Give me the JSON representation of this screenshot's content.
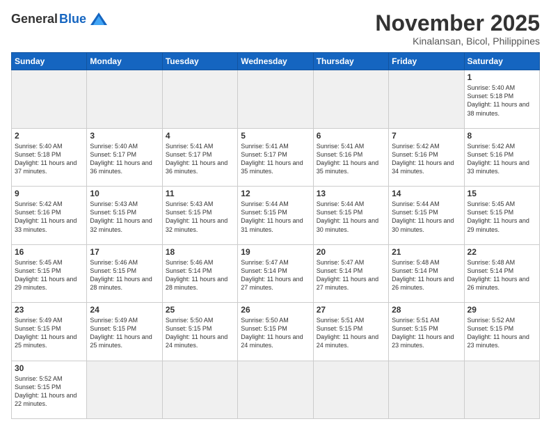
{
  "header": {
    "logo_general": "General",
    "logo_blue": "Blue",
    "month_title": "November 2025",
    "location": "Kinalansan, Bicol, Philippines"
  },
  "days_of_week": [
    "Sunday",
    "Monday",
    "Tuesday",
    "Wednesday",
    "Thursday",
    "Friday",
    "Saturday"
  ],
  "weeks": [
    [
      {
        "day": "",
        "empty": true
      },
      {
        "day": "",
        "empty": true
      },
      {
        "day": "",
        "empty": true
      },
      {
        "day": "",
        "empty": true
      },
      {
        "day": "",
        "empty": true
      },
      {
        "day": "",
        "empty": true
      },
      {
        "day": "1",
        "sunrise": "5:40 AM",
        "sunset": "5:18 PM",
        "daylight": "11 hours and 38 minutes."
      }
    ],
    [
      {
        "day": "2",
        "sunrise": "5:40 AM",
        "sunset": "5:18 PM",
        "daylight": "11 hours and 37 minutes."
      },
      {
        "day": "3",
        "sunrise": "5:40 AM",
        "sunset": "5:17 PM",
        "daylight": "11 hours and 36 minutes."
      },
      {
        "day": "4",
        "sunrise": "5:41 AM",
        "sunset": "5:17 PM",
        "daylight": "11 hours and 36 minutes."
      },
      {
        "day": "5",
        "sunrise": "5:41 AM",
        "sunset": "5:17 PM",
        "daylight": "11 hours and 35 minutes."
      },
      {
        "day": "6",
        "sunrise": "5:41 AM",
        "sunset": "5:16 PM",
        "daylight": "11 hours and 35 minutes."
      },
      {
        "day": "7",
        "sunrise": "5:42 AM",
        "sunset": "5:16 PM",
        "daylight": "11 hours and 34 minutes."
      },
      {
        "day": "8",
        "sunrise": "5:42 AM",
        "sunset": "5:16 PM",
        "daylight": "11 hours and 33 minutes."
      }
    ],
    [
      {
        "day": "9",
        "sunrise": "5:42 AM",
        "sunset": "5:16 PM",
        "daylight": "11 hours and 33 minutes."
      },
      {
        "day": "10",
        "sunrise": "5:43 AM",
        "sunset": "5:15 PM",
        "daylight": "11 hours and 32 minutes."
      },
      {
        "day": "11",
        "sunrise": "5:43 AM",
        "sunset": "5:15 PM",
        "daylight": "11 hours and 32 minutes."
      },
      {
        "day": "12",
        "sunrise": "5:44 AM",
        "sunset": "5:15 PM",
        "daylight": "11 hours and 31 minutes."
      },
      {
        "day": "13",
        "sunrise": "5:44 AM",
        "sunset": "5:15 PM",
        "daylight": "11 hours and 30 minutes."
      },
      {
        "day": "14",
        "sunrise": "5:44 AM",
        "sunset": "5:15 PM",
        "daylight": "11 hours and 30 minutes."
      },
      {
        "day": "15",
        "sunrise": "5:45 AM",
        "sunset": "5:15 PM",
        "daylight": "11 hours and 29 minutes."
      }
    ],
    [
      {
        "day": "16",
        "sunrise": "5:45 AM",
        "sunset": "5:15 PM",
        "daylight": "11 hours and 29 minutes."
      },
      {
        "day": "17",
        "sunrise": "5:46 AM",
        "sunset": "5:15 PM",
        "daylight": "11 hours and 28 minutes."
      },
      {
        "day": "18",
        "sunrise": "5:46 AM",
        "sunset": "5:14 PM",
        "daylight": "11 hours and 28 minutes."
      },
      {
        "day": "19",
        "sunrise": "5:47 AM",
        "sunset": "5:14 PM",
        "daylight": "11 hours and 27 minutes."
      },
      {
        "day": "20",
        "sunrise": "5:47 AM",
        "sunset": "5:14 PM",
        "daylight": "11 hours and 27 minutes."
      },
      {
        "day": "21",
        "sunrise": "5:48 AM",
        "sunset": "5:14 PM",
        "daylight": "11 hours and 26 minutes."
      },
      {
        "day": "22",
        "sunrise": "5:48 AM",
        "sunset": "5:14 PM",
        "daylight": "11 hours and 26 minutes."
      }
    ],
    [
      {
        "day": "23",
        "sunrise": "5:49 AM",
        "sunset": "5:15 PM",
        "daylight": "11 hours and 25 minutes."
      },
      {
        "day": "24",
        "sunrise": "5:49 AM",
        "sunset": "5:15 PM",
        "daylight": "11 hours and 25 minutes."
      },
      {
        "day": "25",
        "sunrise": "5:50 AM",
        "sunset": "5:15 PM",
        "daylight": "11 hours and 24 minutes."
      },
      {
        "day": "26",
        "sunrise": "5:50 AM",
        "sunset": "5:15 PM",
        "daylight": "11 hours and 24 minutes."
      },
      {
        "day": "27",
        "sunrise": "5:51 AM",
        "sunset": "5:15 PM",
        "daylight": "11 hours and 24 minutes."
      },
      {
        "day": "28",
        "sunrise": "5:51 AM",
        "sunset": "5:15 PM",
        "daylight": "11 hours and 23 minutes."
      },
      {
        "day": "29",
        "sunrise": "5:52 AM",
        "sunset": "5:15 PM",
        "daylight": "11 hours and 23 minutes."
      }
    ],
    [
      {
        "day": "30",
        "sunrise": "5:52 AM",
        "sunset": "5:15 PM",
        "daylight": "11 hours and 22 minutes."
      },
      {
        "day": "",
        "empty": true
      },
      {
        "day": "",
        "empty": true
      },
      {
        "day": "",
        "empty": true
      },
      {
        "day": "",
        "empty": true
      },
      {
        "day": "",
        "empty": true
      },
      {
        "day": "",
        "empty": true
      }
    ]
  ]
}
